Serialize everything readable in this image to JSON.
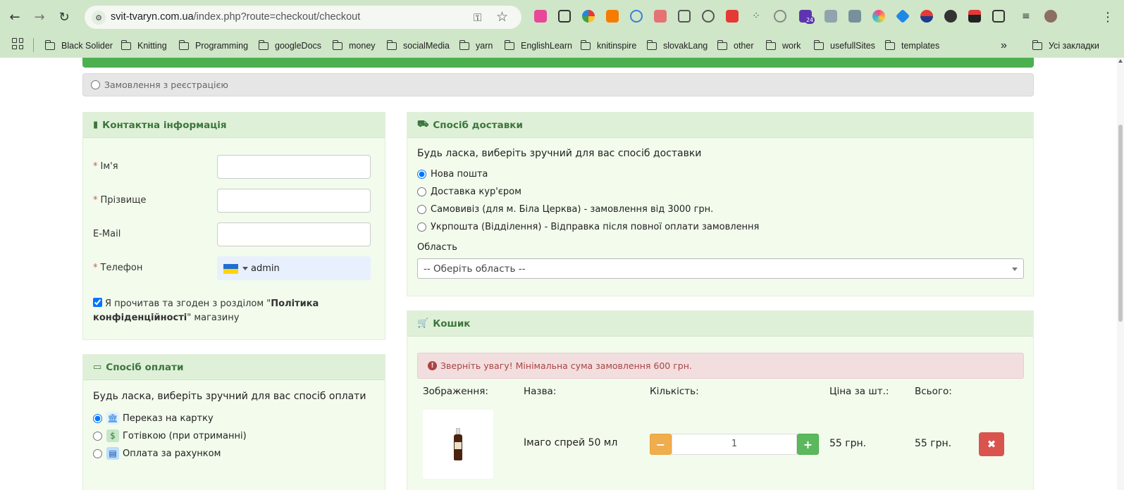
{
  "browser": {
    "url_host": "svit-tvaryn.com.ua",
    "url_path": "/index.php?route=checkout/checkout",
    "bookmarks": [
      "Black Solider",
      "Knitting",
      "Programming",
      "googleDocs",
      "money",
      "socialMedia",
      "yarn",
      "EnglishLearn",
      "knitinspire",
      "slovakLang",
      "other",
      "work",
      "usefullSites",
      "templates"
    ],
    "all_bookmarks": "Усі закладки",
    "ext_badge": "24"
  },
  "checkout": {
    "register_option": "Замовлення з реєстрацією",
    "contact": {
      "title": "Контактна інформація",
      "first_name_label": "Ім'я",
      "last_name_label": "Прізвище",
      "email_label": "E-Mail",
      "phone_label": "Телефон",
      "phone_value": "admin",
      "required_mark": "*",
      "agree_prefix": "Я прочитав та згоден з розділом \"",
      "agree_link": "Політика конфіденційності",
      "agree_suffix": "\" магазину"
    },
    "payment": {
      "title": "Спосіб оплати",
      "intro": "Будь ласка, виберіть зручний для вас спосіб оплати",
      "options": [
        "Переказ на картку",
        "Готівкою (при отриманні)",
        "Оплата за рахунком"
      ]
    },
    "delivery": {
      "title": "Спосіб доставки",
      "intro": "Будь ласка, виберіть зручний для вас спосіб доставки",
      "options": [
        "Нова пошта",
        "Доставка кур'єром",
        "Самовивіз (для м. Біла Церква) - замовлення від 3000 грн.",
        "Укрпошта (Відділення) - Відправка після повної оплати замовлення"
      ],
      "region_label": "Область",
      "region_placeholder": "-- Оберіть область --"
    },
    "cart": {
      "title": "Кошик",
      "alert": "Зверніть увагу! Мінімальна сума замовлення 600 грн.",
      "columns": [
        "Зображення:",
        "Назва:",
        "Кількість:",
        "Ціна за шт.:",
        "Всього:"
      ],
      "items": [
        {
          "name": "Імаго спрей 50 мл",
          "qty": "1",
          "price": "55 грн.",
          "total": "55 грн."
        }
      ],
      "minus_label": "−",
      "plus_label": "+",
      "remove_label": "✖"
    }
  },
  "colors": {
    "panel_head_bg": "#dff0d8",
    "panel_head_text": "#3c763d",
    "alert_bg": "#f2dede",
    "alert_text": "#a94442",
    "minus_btn": "#f0ad4e",
    "plus_btn": "#5cb85c",
    "remove_btn": "#d9534f"
  }
}
